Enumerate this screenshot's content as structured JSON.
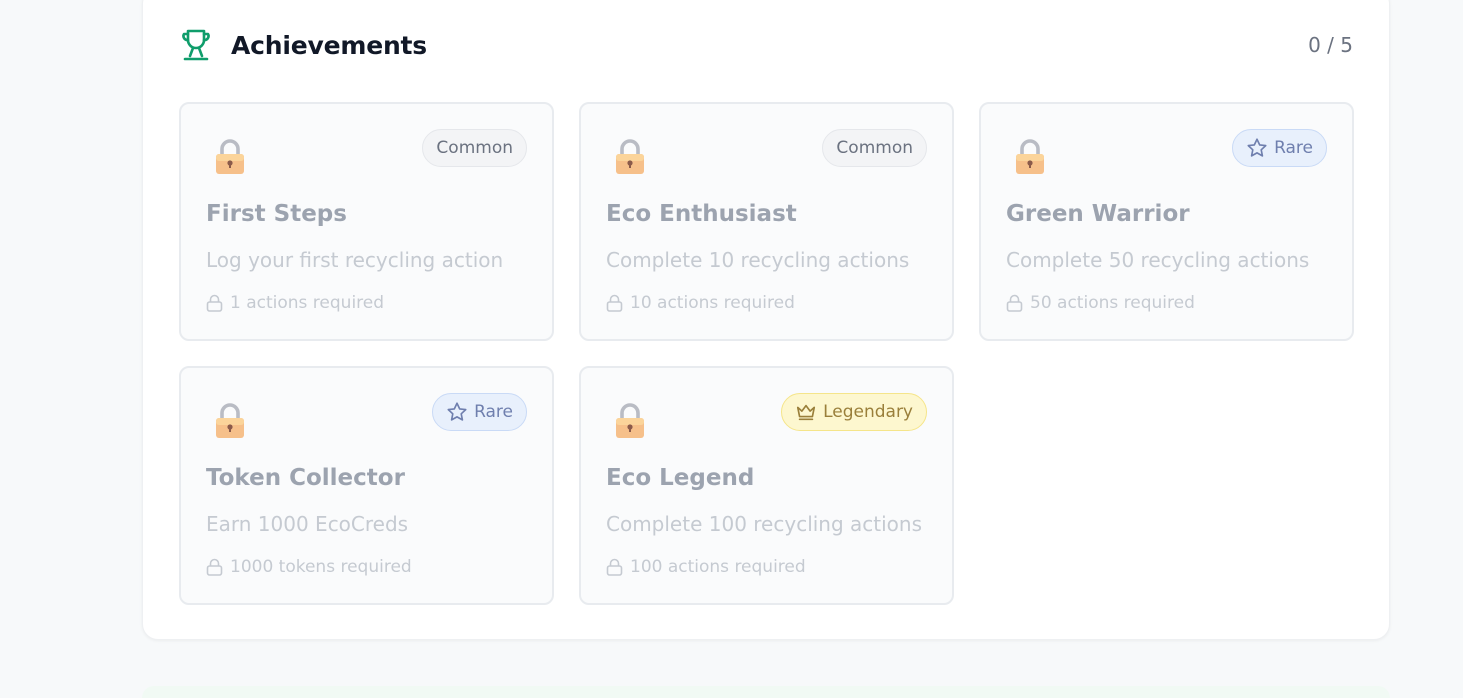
{
  "section": {
    "title": "Achievements",
    "progress": "0 / 5",
    "accent_color": "#0f9d6b"
  },
  "achievements": [
    {
      "name": "First Steps",
      "description": "Log your first recycling action",
      "requirement": "1 actions required",
      "rarity": "Common",
      "icon": "lock-icon",
      "locked": true
    },
    {
      "name": "Eco Enthusiast",
      "description": "Complete 10 recycling actions",
      "requirement": "10 actions required",
      "rarity": "Common",
      "icon": "lock-icon",
      "locked": true
    },
    {
      "name": "Green Warrior",
      "description": "Complete 50 recycling actions",
      "requirement": "50 actions required",
      "rarity": "Rare",
      "icon": "lock-icon",
      "locked": true
    },
    {
      "name": "Token Collector",
      "description": "Earn 1000 EcoCreds",
      "requirement": "1000 tokens required",
      "rarity": "Rare",
      "icon": "lock-icon",
      "locked": true
    },
    {
      "name": "Eco Legend",
      "description": "Complete 100 recycling actions",
      "requirement": "100 actions required",
      "rarity": "Legendary",
      "icon": "lock-icon",
      "locked": true
    }
  ]
}
